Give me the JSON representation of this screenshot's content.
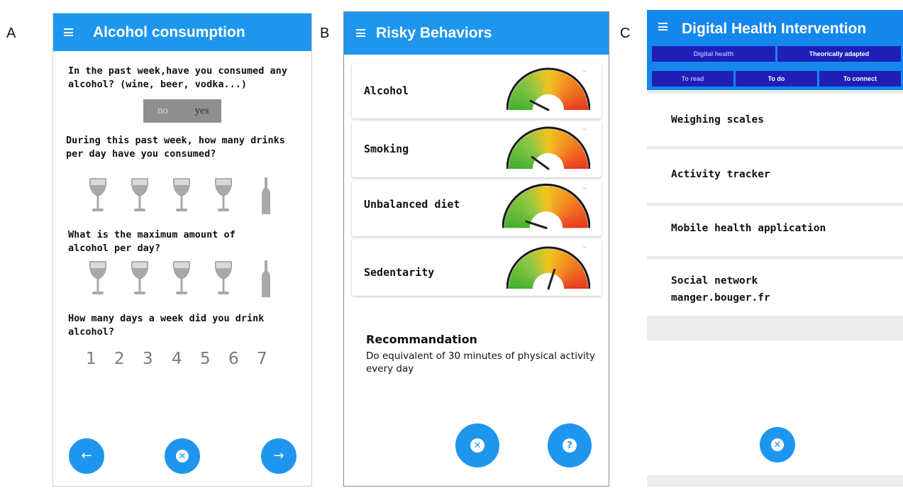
{
  "panel_labels": [
    "A",
    "B",
    "C"
  ],
  "panel_a": {
    "title": "Alcohol consumption",
    "questions": [
      "In the past week,have you consumed any alcohol? (wine, beer, vodka...)",
      "During this past week, how many drinks per day have you consumed?",
      "What is the maximum amount of alcohol per day?",
      "How many days a week did you drink alcohol?"
    ],
    "toggle": {
      "options": [
        "no",
        "yes"
      ],
      "selected": "no"
    },
    "drink_icons": [
      "wine-glass-icon",
      "wine-glass-icon",
      "wine-glass-icon",
      "wine-glass-icon",
      "bottle-icon"
    ],
    "days": [
      "1",
      "2",
      "3",
      "4",
      "5",
      "6",
      "7"
    ],
    "buttons": [
      "back-arrow-icon",
      "close-icon",
      "forward-arrow-icon"
    ]
  },
  "panel_b": {
    "title": "Risky Behaviors",
    "behaviors": [
      {
        "label": "Alcohol",
        "level": 0.15
      },
      {
        "label": "Smoking",
        "level": 0.2
      },
      {
        "label": "Unbalanced diet",
        "level": 0.1
      },
      {
        "label": "Sedentarity",
        "level": 0.6
      }
    ],
    "recommendation_title": "Recommandation",
    "recommendation_text": "Do equivalent of 30 minutes of physical activity every day",
    "buttons": [
      "close-icon",
      "help-icon"
    ]
  },
  "panel_c": {
    "title": "Digital Health Intervention",
    "tabs_row1": [
      "Digital health",
      "Theorically adapted"
    ],
    "tabs_row2": [
      "To read",
      "To do",
      "To connect"
    ],
    "items": [
      "Weighing scales",
      "Activity tracker",
      "Mobile health application",
      "Social network",
      "manger.bouger.fr"
    ],
    "buttons": [
      "close-icon"
    ]
  },
  "colors": {
    "app_bar": "#1e96ee",
    "tab_bg": "#1f1fb8",
    "gauge_green": "#3fae2a",
    "gauge_yellow": "#f2c21b",
    "gauge_red": "#e8331c"
  }
}
